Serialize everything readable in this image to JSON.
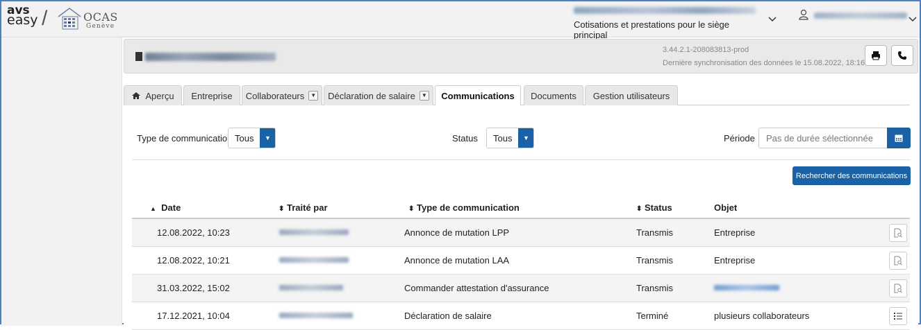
{
  "header": {
    "logo_avs_top": "avs",
    "logo_avs_bottom": "easy",
    "logo_ocas": "OCAS",
    "logo_ocas_sub": "Genève",
    "org_subtitle": "Cotisations et prestations pour le siège principal"
  },
  "company": {
    "version": "3.44.2.1-208083813-prod",
    "sync": "Dernière synchronisation des données le 15.08.2022, 18:16"
  },
  "tabs": [
    {
      "label": "Aperçu",
      "icon": "home-icon"
    },
    {
      "label": "Entreprise"
    },
    {
      "label": "Collaborateurs",
      "dropdown": true
    },
    {
      "label": "Déclaration de salaire",
      "dropdown": true
    },
    {
      "label": "Communications",
      "active": true
    },
    {
      "label": "Documents"
    },
    {
      "label": "Gestion utilisateurs"
    }
  ],
  "filters": {
    "type_label": "Type de communication",
    "type_value": "Tous",
    "status_label": "Status",
    "status_value": "Tous",
    "period_label": "Période",
    "period_placeholder": "Pas de durée sélectionnée"
  },
  "search_button": "Rechercher des communications",
  "table": {
    "headers": {
      "date": "Date",
      "treated_by": "Traité par",
      "type": "Type de communication",
      "status": "Status",
      "object": "Objet"
    },
    "rows": [
      {
        "date": "12.08.2022, 10:23",
        "type": "Annonce de mutation LPP",
        "status": "Transmis",
        "object": "Entreprise",
        "action_icon": "document-preview-icon"
      },
      {
        "date": "12.08.2022, 10:21",
        "type": "Annonce de mutation LAA",
        "status": "Transmis",
        "object": "Entreprise",
        "action_icon": "document-preview-icon"
      },
      {
        "date": "31.03.2022, 15:02",
        "type": "Commander attestation d'assurance",
        "status": "Transmis",
        "object": "",
        "action_icon": "document-preview-icon"
      },
      {
        "date": "17.12.2021, 10:04",
        "type": "Déclaration de salaire",
        "status": "Terminé",
        "object": "plusieurs collaborateurs",
        "action_icon": "list-icon"
      }
    ]
  },
  "colors": {
    "accent": "#1a62a5",
    "frame": "#4a80c8"
  }
}
